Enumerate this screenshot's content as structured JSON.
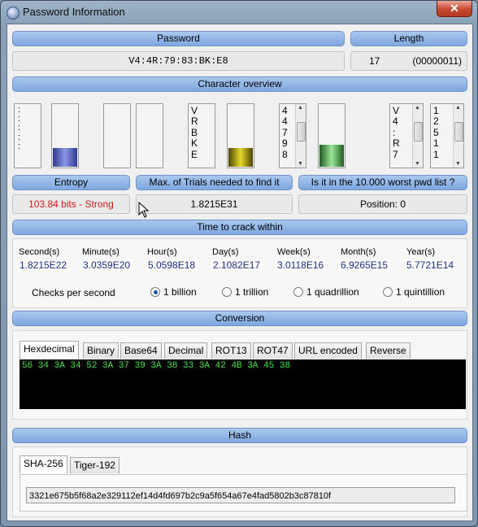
{
  "window": {
    "title": "Password Information",
    "close_label": "✕"
  },
  "password": {
    "header": "Password",
    "value": "V4:4R:79:83:BK:E8"
  },
  "length": {
    "header": "Length",
    "value": "17",
    "binary": "(00000011)"
  },
  "overview": {
    "header": "Character overview",
    "col1_chars": ":\n:\n:\n:\n:",
    "col2_chars": "V\nR\nB\nK\nE",
    "col3_chars": "4\n4\n7\n9\n8",
    "col4_chars": "V\n4\n:\nR\n7",
    "col5_chars": "1\n2\n5\n1\n1",
    "bar_blue_level": 0.3,
    "bar_yellow_level": 0.3,
    "bar_green_level": 0.35
  },
  "entropy": {
    "header": "Entropy",
    "value": "103.84 bits - Strong",
    "color": "#d11a1a"
  },
  "trials": {
    "header": "Max. of Trials needed to find it",
    "value": "1.8215E31"
  },
  "worst": {
    "header": "Is it in the 10.000 worst pwd list ?",
    "value": "Position: 0"
  },
  "crack": {
    "header": "Time to crack within",
    "units": [
      {
        "label": "Second(s)",
        "value": "1.8215E22"
      },
      {
        "label": "Minute(s)",
        "value": "3.0359E20"
      },
      {
        "label": "Hour(s)",
        "value": "5.0598E18"
      },
      {
        "label": "Day(s)",
        "value": "2.1082E17"
      },
      {
        "label": "Week(s)",
        "value": "3.0118E16"
      },
      {
        "label": "Month(s)",
        "value": "6.9265E15"
      },
      {
        "label": "Year(s)",
        "value": "5.7721E14"
      }
    ],
    "checks_label": "Checks per second",
    "options": [
      "1 billion",
      "1 trillion",
      "1 quadrillion",
      "1 quintillion"
    ],
    "selected": "1 billion"
  },
  "conversion": {
    "header": "Conversion",
    "tabs": [
      "Hexdecimal",
      "Binary",
      "Base64",
      "Decimal",
      "ROT13",
      "ROT47",
      "URL encoded",
      "Reverse"
    ],
    "active_tab": "Hexdecimal",
    "output": "56 34 3A 34 52 3A 37 39 3A 38 33 3A 42 4B 3A 45 38"
  },
  "hash": {
    "header": "Hash",
    "tabs": [
      "SHA-256",
      "Tiger-192"
    ],
    "active_tab": "SHA-256",
    "value": "3321e675b5f68a2e329112ef14d4fd697b2c9a5f654a67e4fad5802b3c87810f"
  }
}
